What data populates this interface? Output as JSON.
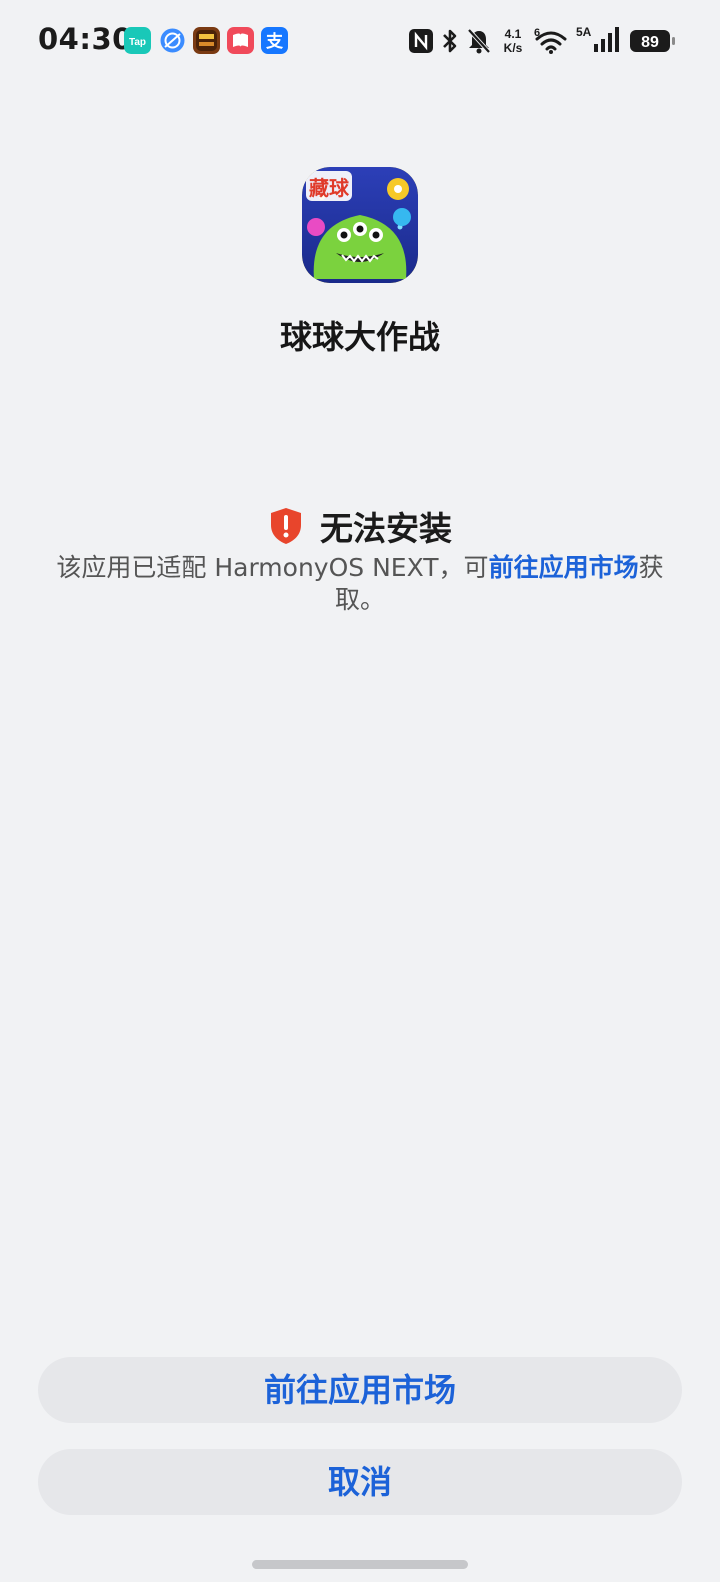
{
  "status_bar": {
    "time": "04:30",
    "notifications": [
      {
        "name": "taptap-icon",
        "label": "Tap",
        "color": "#19c8b8"
      },
      {
        "name": "browser-icon",
        "color": "#3b8cff"
      },
      {
        "name": "game-app-icon",
        "color": "#7a3a12"
      },
      {
        "name": "reader-app-icon",
        "color": "#f04a5a"
      },
      {
        "name": "alipay-icon",
        "label": "支",
        "color": "#1677ff"
      }
    ],
    "network_speed_value": "4.1",
    "network_speed_unit": "K/s",
    "wifi_badge": "6",
    "cellular_badge": "5A",
    "battery": "89"
  },
  "app": {
    "name": "球球大作战",
    "icon_text": "藏球"
  },
  "error": {
    "title": "无法安装",
    "message_before": "该应用已适配 HarmonyOS NEXT，可",
    "message_link": "前往应用市场",
    "message_after": "获取。"
  },
  "buttons": {
    "go_market": "前往应用市场",
    "cancel": "取消"
  },
  "colors": {
    "accent": "#1c62d8",
    "warning": "#e8452c",
    "background": "#f1f2f4"
  }
}
